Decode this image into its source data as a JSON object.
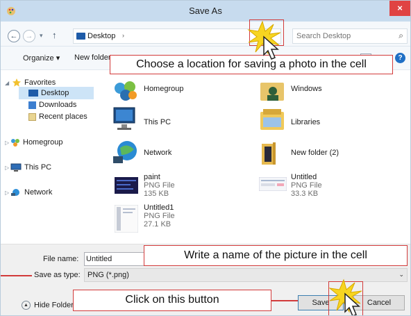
{
  "window": {
    "title": "Save As",
    "close_label": "×"
  },
  "nav": {
    "back_glyph": "←",
    "forward_glyph": "→",
    "dropdown_glyph": "▾",
    "up_glyph": "↑",
    "address": {
      "location": "Desktop",
      "arrow": "›"
    },
    "search": {
      "placeholder": "Search Desktop",
      "icon": "search-icon"
    }
  },
  "toolbar": {
    "organize_label": "Organize ▾",
    "new_folder_label": "New folder",
    "help_label": "?"
  },
  "sidebar": {
    "items": [
      {
        "label": "Favorites",
        "icon": "star-icon"
      },
      {
        "label": "Desktop",
        "icon": "desktop-icon",
        "selected": true
      },
      {
        "label": "Downloads",
        "icon": "downloads-icon"
      },
      {
        "label": "Recent places",
        "icon": "recent-places-icon"
      },
      {
        "label": "Homegroup",
        "icon": "homegroup-icon"
      },
      {
        "label": "This PC",
        "icon": "computer-icon"
      },
      {
        "label": "Network",
        "icon": "network-icon"
      }
    ]
  },
  "files": [
    {
      "name": "Homegroup",
      "icon": "homegroup-icon"
    },
    {
      "name": "Windows",
      "icon": "user-folder-icon"
    },
    {
      "name": "This PC",
      "icon": "computer-icon"
    },
    {
      "name": "Libraries",
      "icon": "libraries-icon"
    },
    {
      "name": "Network",
      "icon": "network-icon"
    },
    {
      "name": "New folder (2)",
      "icon": "folder-icon"
    },
    {
      "name": "paint",
      "type": "PNG File",
      "size": "135 KB",
      "icon": "image-thumbnail-icon"
    },
    {
      "name": "Untitled",
      "type": "PNG File",
      "size": "33.3 KB",
      "icon": "image-thumbnail-icon"
    },
    {
      "name": "Untitled1",
      "type": "PNG File",
      "size": "27.1 KB",
      "icon": "image-thumbnail-icon"
    }
  ],
  "form": {
    "file_name_label": "File name:",
    "file_name_value": "Untitled",
    "save_type_label": "Save as type:",
    "save_type_value": "PNG (*.png)",
    "dropdown_glyph": "⌄"
  },
  "buttons": {
    "hide_folders": "Hide Folders",
    "save": "Save",
    "cancel": "Cancel"
  },
  "annotations": {
    "location": "Choose a location  for saving a photo in the cell",
    "filename": "Write a name of the picture in the cell",
    "button": "Click on this button"
  },
  "colors": {
    "annotation_red": "#d23a3a",
    "starburst_yellow": "#f7d520",
    "titlebar": "#c7dbee",
    "selected": "#cde4f7"
  }
}
